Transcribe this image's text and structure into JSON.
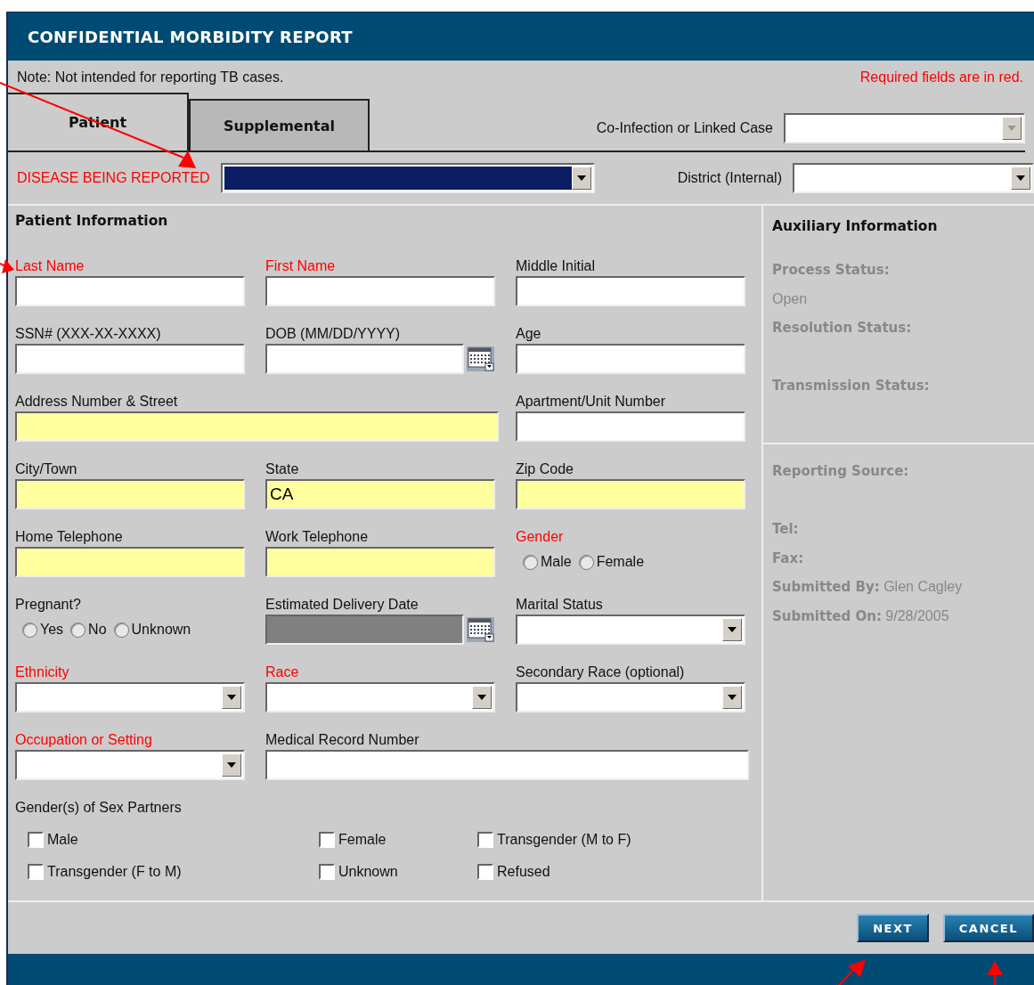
{
  "title": "CONFIDENTIAL MORBIDITY REPORT",
  "note": "Note: Not intended for reporting TB cases.",
  "required_note": "Required fields are in red.",
  "tabs": [
    {
      "label": "Patient",
      "selected": true
    },
    {
      "label": "Supplemental",
      "selected": false
    }
  ],
  "linked_case": {
    "label": "Co-Infection or Linked Case",
    "disabled": true
  },
  "disease": {
    "label": "DISEASE BEING REPORTED",
    "required": true,
    "focused": true
  },
  "district": {
    "label": "District (Internal)",
    "disabled": false
  },
  "patient_info": {
    "heading": "Patient Information",
    "fields": [
      {
        "kind": "text",
        "label": "Last Name",
        "required": true,
        "highlighted": false
      },
      {
        "kind": "text",
        "label": "First Name",
        "required": true,
        "highlighted": false
      },
      {
        "kind": "text",
        "label": "Middle Initial",
        "required": false,
        "highlighted": false
      },
      {
        "kind": "text",
        "label": "SSN# (XXX-XX-XXXX)",
        "required": false,
        "highlighted": false
      },
      {
        "kind": "date",
        "label": "DOB (MM/DD/YYYY)",
        "required": false,
        "disabled": false
      },
      {
        "kind": "text",
        "label": "Age",
        "required": false,
        "highlighted": false
      },
      {
        "kind": "wide",
        "label": "Address Number & Street",
        "required": false,
        "highlighted": true
      },
      {
        "kind": "text",
        "label": "Apartment/Unit Number",
        "required": false,
        "highlighted": false
      },
      {
        "kind": "text",
        "label": "City/Town",
        "required": false,
        "highlighted": true
      },
      {
        "kind": "text",
        "label": "State",
        "required": false,
        "highlighted": true,
        "value": "CA"
      },
      {
        "kind": "text",
        "label": "Zip Code",
        "required": false,
        "highlighted": true
      },
      {
        "kind": "text",
        "label": "Home Telephone",
        "required": false,
        "highlighted": true
      },
      {
        "kind": "text",
        "label": "Work Telephone",
        "required": false,
        "highlighted": true
      },
      {
        "kind": "radio",
        "label": "Gender",
        "required": true,
        "options": [
          {
            "label": "Male",
            "selected": false
          },
          {
            "label": "Female",
            "selected": false
          }
        ]
      },
      {
        "kind": "radio",
        "label": "Pregnant?",
        "required": false,
        "options": [
          {
            "label": "Yes",
            "selected": false
          },
          {
            "label": "No",
            "selected": false
          },
          {
            "label": "Unknown",
            "selected": false
          }
        ]
      },
      {
        "kind": "date",
        "label": "Estimated Delivery Date",
        "required": false,
        "disabled": true
      },
      {
        "kind": "select",
        "label": "Marital Status",
        "required": false
      },
      {
        "kind": "select",
        "label": "Ethnicity",
        "required": true
      },
      {
        "kind": "select",
        "label": "Race",
        "required": true
      },
      {
        "kind": "select",
        "label": "Secondary Race (optional)",
        "required": false
      },
      {
        "kind": "select",
        "label": "Occupation or Setting",
        "required": true
      },
      {
        "kind": "wide",
        "label": "Medical Record Number",
        "required": false,
        "highlighted": false
      }
    ]
  },
  "sex_partners": {
    "label": "Gender(s) of Sex Partners",
    "options": [
      {
        "label": "Male",
        "checked": false
      },
      {
        "label": "Female",
        "checked": false
      },
      {
        "label": "Transgender (M to F)",
        "checked": false
      },
      {
        "label": "Transgender (F to M)",
        "checked": false
      },
      {
        "label": "Unknown",
        "checked": false
      },
      {
        "label": "Refused",
        "checked": false
      }
    ]
  },
  "auxiliary": {
    "heading": "Auxiliary Information",
    "sections": [
      {
        "items": [
          {
            "kind": "stacked",
            "label": "Process Status:",
            "value": "Open"
          },
          {
            "kind": "stacked",
            "label": "Resolution Status:"
          },
          {
            "kind": "stacked",
            "label": "Transmission Status:"
          }
        ]
      },
      {
        "items": [
          {
            "kind": "stacked",
            "label": "Reporting Source:"
          },
          {
            "kind": "inline",
            "label": "Tel:"
          },
          {
            "kind": "inline",
            "label": "Fax:"
          },
          {
            "kind": "inline",
            "label": "Submitted By:",
            "value": "Glen Cagley"
          },
          {
            "kind": "inline",
            "label": "Submitted On:",
            "value": "9/28/2005"
          }
        ]
      }
    ]
  },
  "buttons": [
    "NEXT",
    "CANCEL"
  ]
}
